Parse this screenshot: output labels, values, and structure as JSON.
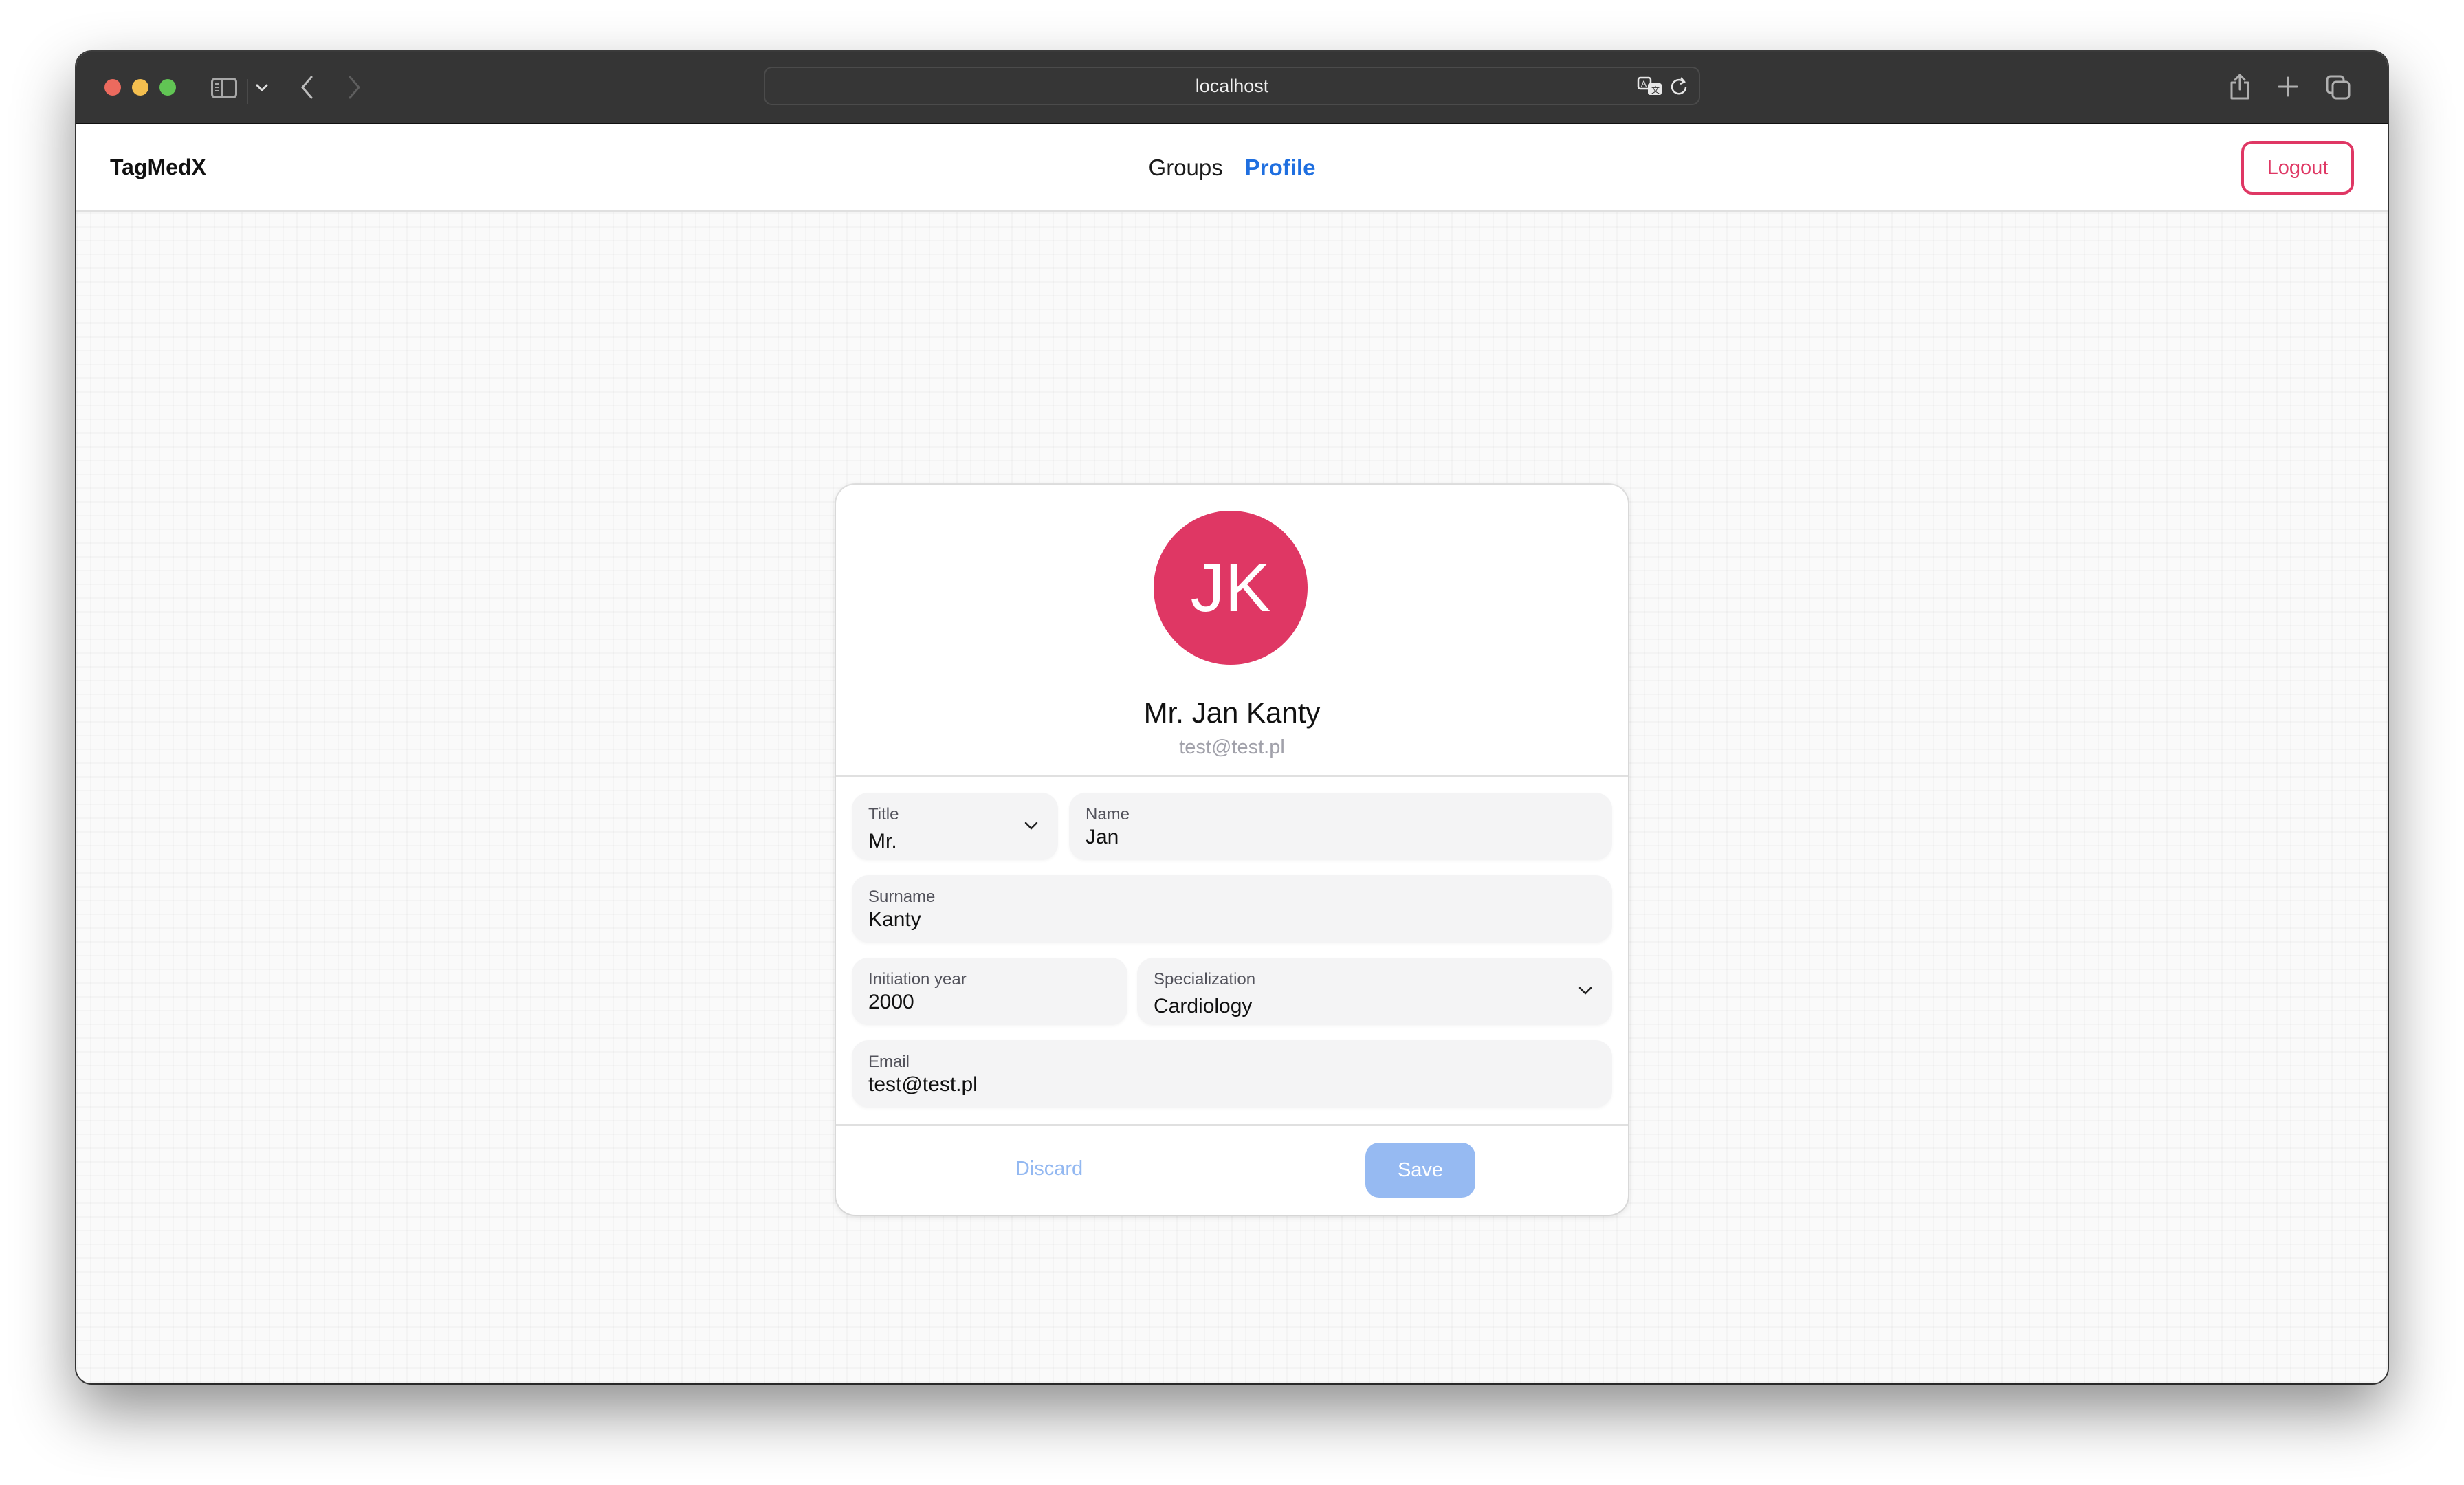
{
  "browser": {
    "url": "localhost",
    "icons": [
      "close-window",
      "minimize-window",
      "zoom-window",
      "sidebar-icon",
      "chevron-down-icon",
      "back-icon",
      "forward-icon",
      "translate-icon",
      "reload-icon",
      "share-icon",
      "new-tab-icon",
      "tab-overview-icon"
    ]
  },
  "navbar": {
    "brand": "TagMedX",
    "links": [
      {
        "label": "Groups",
        "active": false
      },
      {
        "label": "Profile",
        "active": true
      }
    ],
    "logout_label": "Logout"
  },
  "profile": {
    "initials": "JK",
    "full_name": "Mr. Jan Kanty",
    "email": "test@test.pl",
    "avatar_color": "#df3764"
  },
  "form": {
    "title": {
      "label": "Title",
      "value": "Mr."
    },
    "name": {
      "label": "Name",
      "value": "Jan"
    },
    "surname": {
      "label": "Surname",
      "value": "Kanty"
    },
    "initiation_year": {
      "label": "Initiation year",
      "value": "2000"
    },
    "specialization": {
      "label": "Specialization",
      "value": "Cardiology"
    },
    "email": {
      "label": "Email",
      "value": "test@test.pl"
    }
  },
  "actions": {
    "discard_label": "Discard",
    "save_label": "Save"
  },
  "colors": {
    "accent": "#1f6fe0",
    "danger": "#df3764",
    "save_disabled": "#96baf2"
  }
}
